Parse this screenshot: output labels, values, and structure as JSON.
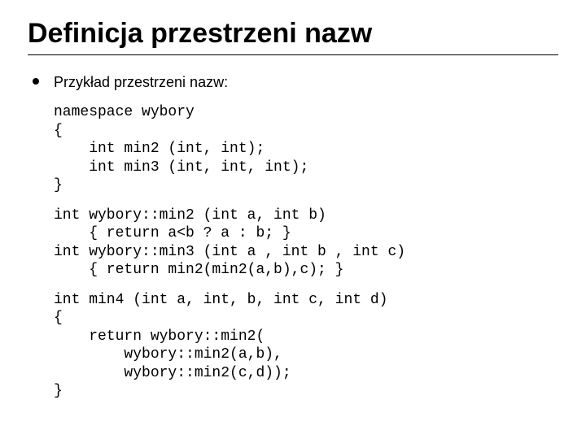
{
  "title": "Definicja przestrzeni nazw",
  "bullet": "Przykład przestrzeni nazw:",
  "code": {
    "block1": "namespace wybory\n{\n    int min2 (int, int);\n    int min3 (int, int, int);\n}",
    "block2": "int wybory::min2 (int a, int b)\n    { return a<b ? a : b; }\nint wybory::min3 (int a , int b , int c)\n    { return min2(min2(a,b),c); }",
    "block3": "int min4 (int a, int, b, int c, int d)\n{\n    return wybory::min2(\n        wybory::min2(a,b),\n        wybory::min2(c,d));\n}"
  }
}
